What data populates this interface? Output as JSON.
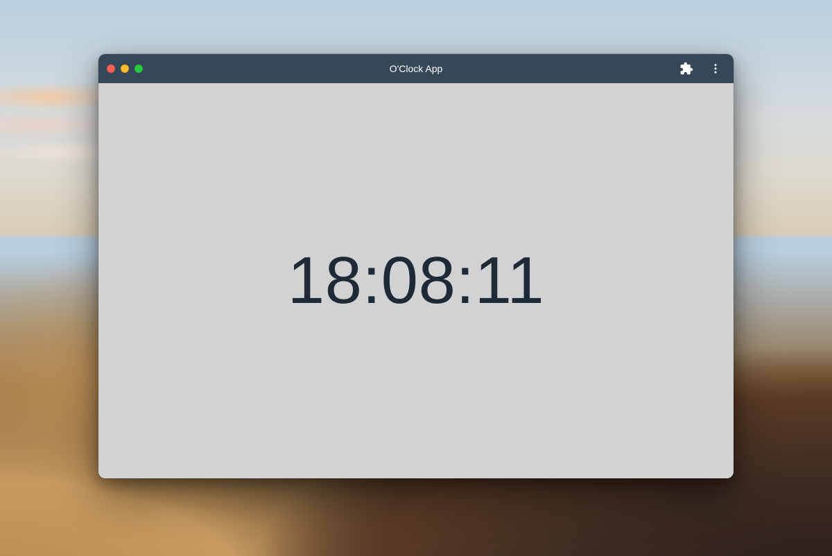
{
  "window": {
    "title": "O'Clock App"
  },
  "clock": {
    "time": "18:08:11"
  },
  "titlebar": {
    "extensions_icon": "puzzle-piece",
    "menu_icon": "more-vertical"
  },
  "traffic_lights": {
    "close": "close",
    "minimize": "minimize",
    "zoom": "zoom"
  }
}
